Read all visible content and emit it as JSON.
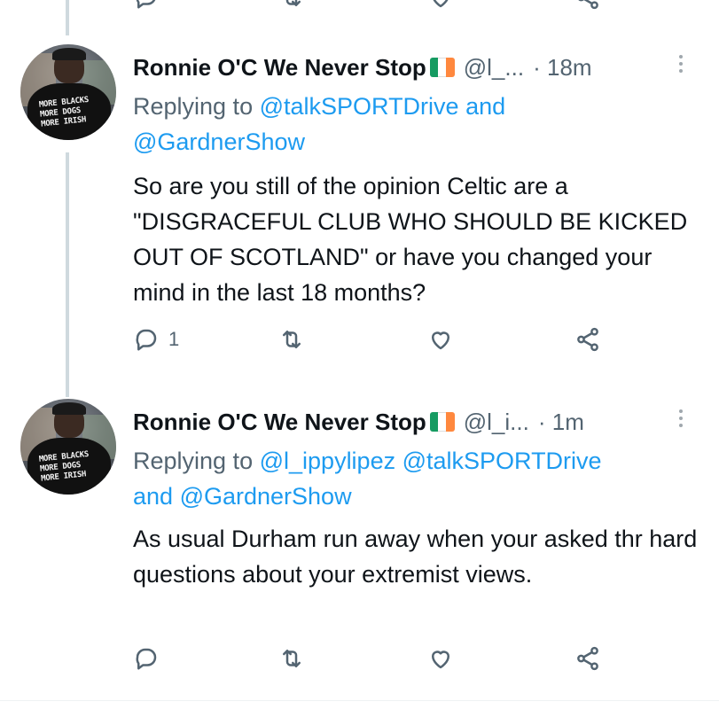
{
  "colors": {
    "link": "#1d9bf0",
    "secondary_text": "#536471",
    "thread_line": "#cfd9de",
    "flag_green": "#169b62",
    "flag_white": "#ffffff",
    "flag_orange": "#ff883e"
  },
  "tweets": [
    {
      "author_name": "Ronnie O'C We Never Stop",
      "flag_emoji": "ireland-flag",
      "handle": "@l_...",
      "separator": "·",
      "time": "18m",
      "avatar_shirt_text": "MORE BLACKS\nMORE DOGS\nMORE IRISH",
      "reply_prefix": "Replying to",
      "reply_link_1": "@talkSPORTDrive",
      "reply_and": "and",
      "reply_link_2": "@GardnerShow",
      "text": "So are you still of the opinion Celtic are a \"DISGRACEFUL CLUB WHO SHOULD BE KICKED OUT OF SCOTLAND\" or have you changed your mind in the last 18 months?",
      "reply_count": "1",
      "icons": [
        "reply-icon",
        "retweet-icon",
        "like-icon",
        "share-icon"
      ]
    },
    {
      "author_name": "Ronnie O'C We Never Stop",
      "flag_emoji": "ireland-flag",
      "handle": "@l_i...",
      "separator": "·",
      "time": "1m",
      "avatar_shirt_text": "MORE BLACKS\nMORE DOGS\nMORE IRISH",
      "reply_prefix": "Replying to",
      "reply_link_1": "@l_ippylipez",
      "reply_link_2": "@talkSPORTDrive",
      "reply_and": "and",
      "reply_link_3": "@GardnerShow",
      "text": "As usual Durham run away when your asked thr hard questions about your extremist views.",
      "reply_count": "",
      "icons": [
        "reply-icon",
        "retweet-icon",
        "like-icon",
        "share-icon"
      ]
    }
  ]
}
